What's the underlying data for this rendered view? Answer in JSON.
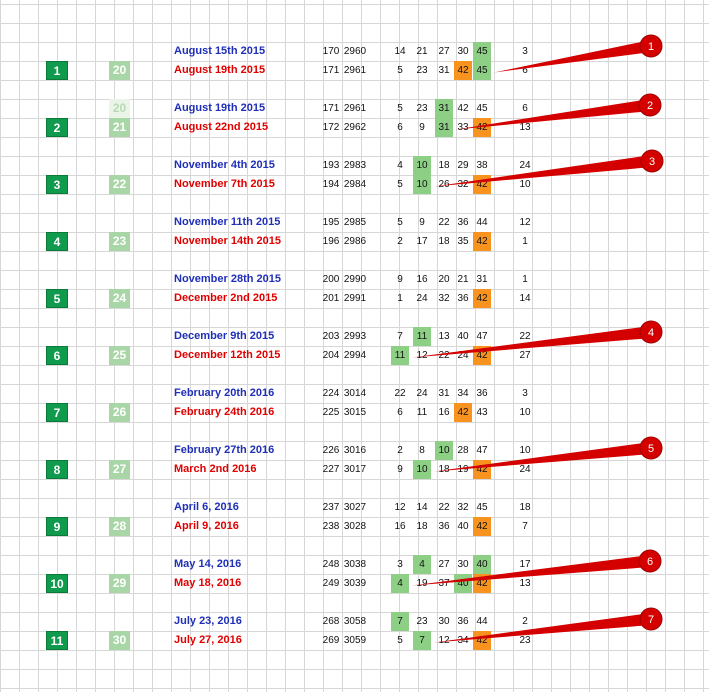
{
  "groups": [
    {
      "index": "1",
      "sub_top": "",
      "sub_bottom": "20",
      "top": {
        "date": "August 15th 2015",
        "draw": "170",
        "id": "2960",
        "nums": [
          "14",
          "21",
          "27",
          "30",
          "45",
          "3"
        ],
        "hl": [
          "",
          "",
          "",
          "",
          "g",
          ""
        ]
      },
      "bottom": {
        "date": "August 19th 2015",
        "draw": "171",
        "id": "2961",
        "nums": [
          "5",
          "23",
          "31",
          "42",
          "45",
          "6"
        ],
        "hl": [
          "",
          "",
          "",
          "o",
          "g",
          ""
        ]
      },
      "pointer": "1"
    },
    {
      "index": "2",
      "sub_top": "20",
      "sub_bottom": "21",
      "top": {
        "date": "August 19th 2015",
        "draw": "171",
        "id": "2961",
        "nums": [
          "5",
          "23",
          "31",
          "42",
          "45",
          "6"
        ],
        "hl": [
          "",
          "",
          "g",
          "",
          "",
          ""
        ]
      },
      "bottom": {
        "date": "August 22nd 2015",
        "draw": "172",
        "id": "2962",
        "nums": [
          "6",
          "9",
          "31",
          "33",
          "42",
          "13"
        ],
        "hl": [
          "",
          "",
          "g",
          "",
          "o",
          ""
        ]
      },
      "pointer": "2"
    },
    {
      "index": "3",
      "sub_top": "",
      "sub_bottom": "22",
      "top": {
        "date": "November 4th 2015",
        "draw": "193",
        "id": "2983",
        "nums": [
          "4",
          "10",
          "18",
          "29",
          "38",
          "24"
        ],
        "hl": [
          "",
          "g",
          "",
          "",
          "",
          ""
        ]
      },
      "bottom": {
        "date": "November 7th 2015",
        "draw": "194",
        "id": "2984",
        "nums": [
          "5",
          "10",
          "26",
          "32",
          "42",
          "10"
        ],
        "hl": [
          "",
          "g",
          "",
          "",
          "o",
          ""
        ]
      },
      "pointer": "3"
    },
    {
      "index": "4",
      "sub_top": "",
      "sub_bottom": "23",
      "top": {
        "date": "November 11th 2015",
        "draw": "195",
        "id": "2985",
        "nums": [
          "5",
          "9",
          "22",
          "36",
          "44",
          "12"
        ],
        "hl": [
          "",
          "",
          "",
          "",
          "",
          ""
        ]
      },
      "bottom": {
        "date": "November 14th 2015",
        "draw": "196",
        "id": "2986",
        "nums": [
          "2",
          "17",
          "18",
          "35",
          "42",
          "1"
        ],
        "hl": [
          "",
          "",
          "",
          "",
          "o",
          ""
        ]
      },
      "pointer": ""
    },
    {
      "index": "5",
      "sub_top": "",
      "sub_bottom": "24",
      "top": {
        "date": "November 28th 2015",
        "draw": "200",
        "id": "2990",
        "nums": [
          "9",
          "16",
          "20",
          "21",
          "31",
          "1"
        ],
        "hl": [
          "",
          "",
          "",
          "",
          "",
          ""
        ]
      },
      "bottom": {
        "date": "December 2nd 2015",
        "draw": "201",
        "id": "2991",
        "nums": [
          "1",
          "24",
          "32",
          "36",
          "42",
          "14"
        ],
        "hl": [
          "",
          "",
          "",
          "",
          "o",
          ""
        ]
      },
      "pointer": ""
    },
    {
      "index": "6",
      "sub_top": "",
      "sub_bottom": "25",
      "top": {
        "date": "December 9th 2015",
        "draw": "203",
        "id": "2993",
        "nums": [
          "7",
          "11",
          "13",
          "40",
          "47",
          "22"
        ],
        "hl": [
          "",
          "g",
          "",
          "",
          "",
          ""
        ]
      },
      "bottom": {
        "date": "December 12th 2015",
        "draw": "204",
        "id": "2994",
        "nums": [
          "11",
          "12",
          "22",
          "24",
          "42",
          "27"
        ],
        "hl": [
          "g",
          "",
          "",
          "",
          "o",
          ""
        ]
      },
      "pointer": "4"
    },
    {
      "index": "7",
      "sub_top": "",
      "sub_bottom": "26",
      "top": {
        "date": "February 20th 2016",
        "draw": "224",
        "id": "3014",
        "nums": [
          "22",
          "24",
          "31",
          "34",
          "36",
          "3"
        ],
        "hl": [
          "",
          "",
          "",
          "",
          "",
          ""
        ]
      },
      "bottom": {
        "date": "February 24th 2016",
        "draw": "225",
        "id": "3015",
        "nums": [
          "6",
          "11",
          "16",
          "42",
          "43",
          "10"
        ],
        "hl": [
          "",
          "",
          "",
          "o",
          "",
          ""
        ]
      },
      "pointer": ""
    },
    {
      "index": "8",
      "sub_top": "",
      "sub_bottom": "27",
      "top": {
        "date": "February 27th 2016",
        "draw": "226",
        "id": "3016",
        "nums": [
          "2",
          "8",
          "10",
          "28",
          "47",
          "10"
        ],
        "hl": [
          "",
          "",
          "g",
          "",
          "",
          ""
        ]
      },
      "bottom": {
        "date": "March 2nd 2016",
        "draw": "227",
        "id": "3017",
        "nums": [
          "9",
          "10",
          "18",
          "19",
          "42",
          "24"
        ],
        "hl": [
          "",
          "g",
          "",
          "",
          "o",
          ""
        ]
      },
      "pointer": "5"
    },
    {
      "index": "9",
      "sub_top": "",
      "sub_bottom": "28",
      "top": {
        "date": "April 6, 2016",
        "draw": "237",
        "id": "3027",
        "nums": [
          "12",
          "14",
          "22",
          "32",
          "45",
          "18"
        ],
        "hl": [
          "",
          "",
          "",
          "",
          "",
          ""
        ]
      },
      "bottom": {
        "date": "April 9, 2016",
        "draw": "238",
        "id": "3028",
        "nums": [
          "16",
          "18",
          "36",
          "40",
          "42",
          "7"
        ],
        "hl": [
          "",
          "",
          "",
          "",
          "o",
          ""
        ]
      },
      "pointer": ""
    },
    {
      "index": "10",
      "sub_top": "",
      "sub_bottom": "29",
      "top": {
        "date": "May 14, 2016",
        "draw": "248",
        "id": "3038",
        "nums": [
          "3",
          "4",
          "27",
          "30",
          "40",
          "17"
        ],
        "hl": [
          "",
          "g",
          "",
          "",
          "g",
          ""
        ]
      },
      "bottom": {
        "date": "May 18, 2016",
        "draw": "249",
        "id": "3039",
        "nums": [
          "4",
          "19",
          "37",
          "40",
          "42",
          "13"
        ],
        "hl": [
          "g",
          "",
          "",
          "g",
          "o",
          ""
        ]
      },
      "pointer": "6"
    },
    {
      "index": "11",
      "sub_top": "",
      "sub_bottom": "30",
      "top": {
        "date": "July 23, 2016",
        "draw": "268",
        "id": "3058",
        "nums": [
          "7",
          "23",
          "30",
          "36",
          "44",
          "2"
        ],
        "hl": [
          "g",
          "",
          "",
          "",
          "",
          ""
        ]
      },
      "bottom": {
        "date": "July 27, 2016",
        "draw": "269",
        "id": "3059",
        "nums": [
          "5",
          "7",
          "12",
          "34",
          "42",
          "23"
        ],
        "hl": [
          "",
          "g",
          "",
          "",
          "o",
          ""
        ]
      },
      "pointer": "7"
    }
  ],
  "colors": {
    "top_date": "#1f2fb8",
    "bottom_date": "#e00000",
    "match_green": "#8ecf86",
    "highlight_orange": "#f7931e",
    "index_green": "#0f9a4d",
    "pointer_red": "#d40000"
  }
}
